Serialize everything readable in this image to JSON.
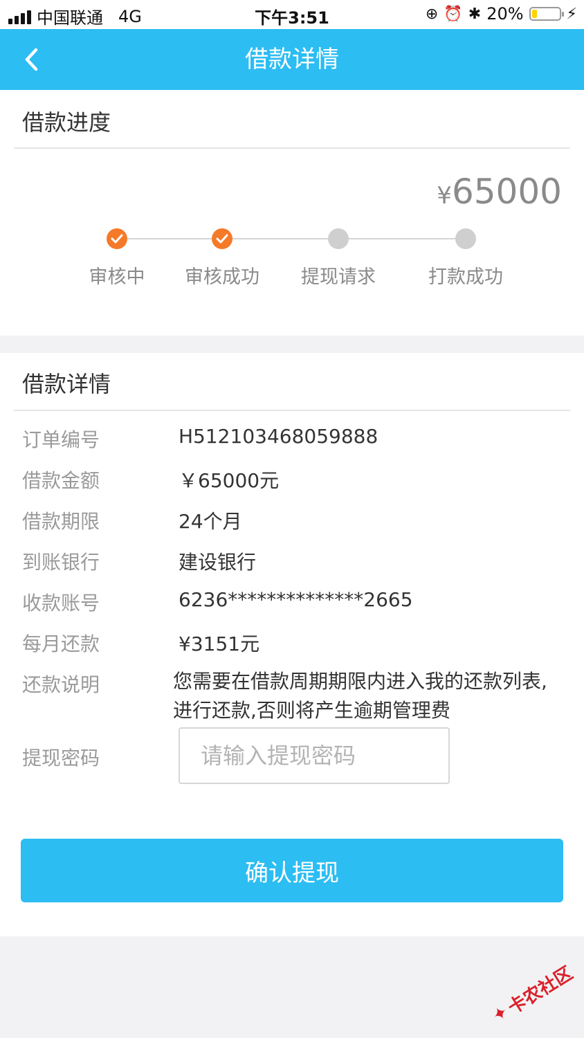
{
  "status_bar": {
    "carrier": "中国联通",
    "network": "4G",
    "time": "下午3:51",
    "battery": "20%",
    "battery_level": 0.2
  },
  "nav": {
    "title": "借款详情",
    "back_icon": "chevron-left-icon"
  },
  "progress_section": {
    "title": "借款进度",
    "amount_currency": "¥",
    "amount_value": "65000",
    "steps": [
      {
        "label": "审核中",
        "done": true
      },
      {
        "label": "审核成功",
        "done": true
      },
      {
        "label": "提现请求",
        "done": false
      },
      {
        "label": "打款成功",
        "done": false
      }
    ]
  },
  "details_section": {
    "title": "借款详情",
    "rows": [
      {
        "label": "订单编号",
        "value": "H512103468059888"
      },
      {
        "label": "借款金额",
        "value": "￥65000元"
      },
      {
        "label": "借款期限",
        "value": "24个月"
      },
      {
        "label": "到账银行",
        "value": "建设银行"
      },
      {
        "label": "收款账号",
        "value": "6236**************2665"
      },
      {
        "label": "每月还款",
        "value": "¥3151元"
      }
    ],
    "note_label": "还款说明",
    "note_value": "您需要在借款周期期限内进入我的还款列表,进行还款,否则将产生逾期管理费",
    "password_label": "提现密码",
    "password_placeholder": "请输入提现密码",
    "password_value": ""
  },
  "confirm_button": "确认提现",
  "watermark": "卡农社区",
  "colors": {
    "primary": "#2cbdf2",
    "done": "#f47a2a",
    "pending": "#cfcfcf"
  }
}
